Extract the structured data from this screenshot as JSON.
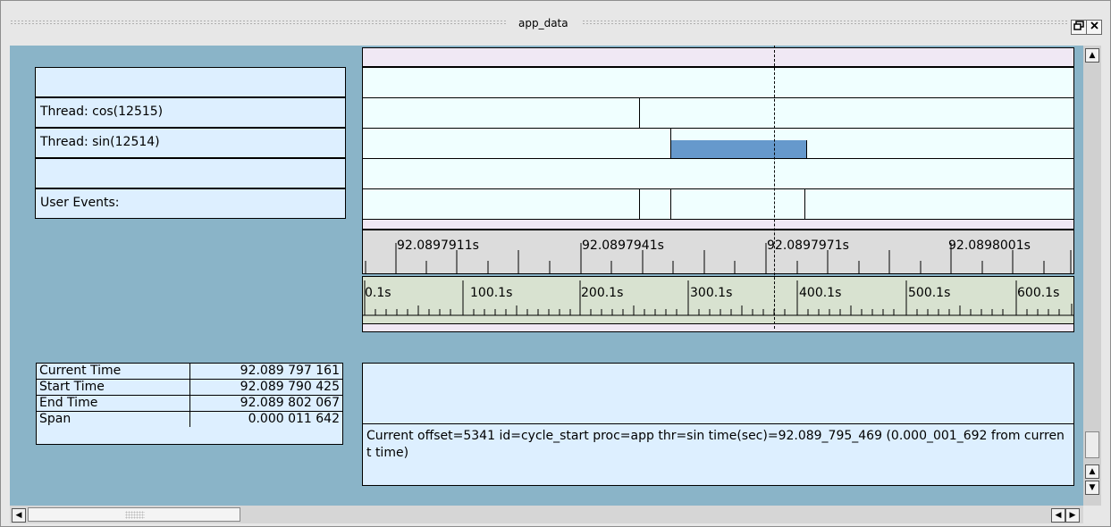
{
  "window": {
    "title": "app_data",
    "restore_icon": "restore-icon",
    "close_icon": "close-icon"
  },
  "rows": [
    {
      "label": ""
    },
    {
      "label": "Thread: cos(12515)"
    },
    {
      "label": "Thread: sin(12514)"
    },
    {
      "label": ""
    },
    {
      "label": "User Events:"
    }
  ],
  "time_ruler": {
    "labels": [
      "92.0897911s",
      "92.0897941s",
      "92.0897971s",
      "92.0898001s"
    ]
  },
  "offset_ruler": {
    "labels": [
      "0.1s",
      "100.1s",
      "200.1s",
      "300.1s",
      "400.1s",
      "500.1s",
      "600.1s"
    ]
  },
  "stats": [
    {
      "label": "Current Time",
      "value": "92.089 797 161"
    },
    {
      "label": "Start Time",
      "value": "92.089 790 425"
    },
    {
      "label": "End Time",
      "value": "92.089 802 067"
    },
    {
      "label": "Span",
      "value": "0.000 011 642"
    }
  ],
  "info": {
    "text": "Current offset=5341  id=cycle_start  proc=app  thr=sin  time(sec)=92.089_795_469   (0.000_001_692 from current time)"
  },
  "colors": {
    "background": "#8ab4c8",
    "label_bg": "#ddefff",
    "track_bg": "#f0ffff",
    "span_bar": "#6699cc",
    "pink_strip": "#f0e8f4",
    "time_ruler_bg": "#dcdcdc",
    "offset_ruler_bg": "#d8e2d0"
  }
}
